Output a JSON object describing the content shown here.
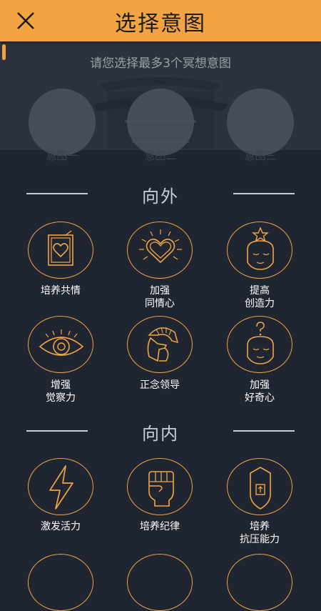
{
  "header": {
    "title": "选择意图",
    "close_icon": "close-icon"
  },
  "subtitle": "请您选择最多3个冥想意图",
  "slots": [
    "意图一",
    "意图二",
    "意图三"
  ],
  "sections": [
    {
      "title": "向外",
      "items": [
        {
          "line1": "培养共情",
          "line2": "",
          "icon": "framed-heart-icon"
        },
        {
          "line1": "加强",
          "line2": "同情心",
          "icon": "radiant-heart-icon"
        },
        {
          "line1": "提高",
          "line2": "创造力",
          "icon": "head-star-icon"
        },
        {
          "line1": "增强",
          "line2": "觉察力",
          "icon": "eye-icon"
        },
        {
          "line1": "正念领导",
          "line2": "",
          "icon": "spartan-helmet-icon"
        },
        {
          "line1": "加强",
          "line2": "好奇心",
          "icon": "head-question-icon"
        }
      ]
    },
    {
      "title": "向内",
      "items": [
        {
          "line1": "激发活力",
          "line2": "",
          "icon": "lightning-icon"
        },
        {
          "line1": "培养纪律",
          "line2": "",
          "icon": "fist-icon"
        },
        {
          "line1": "培养",
          "line2": "抗压能力",
          "icon": "shield-arrow-icon"
        }
      ]
    }
  ],
  "colors": {
    "accent": "#f2a443",
    "background": "#1f2631",
    "panel": "#2c333d"
  }
}
